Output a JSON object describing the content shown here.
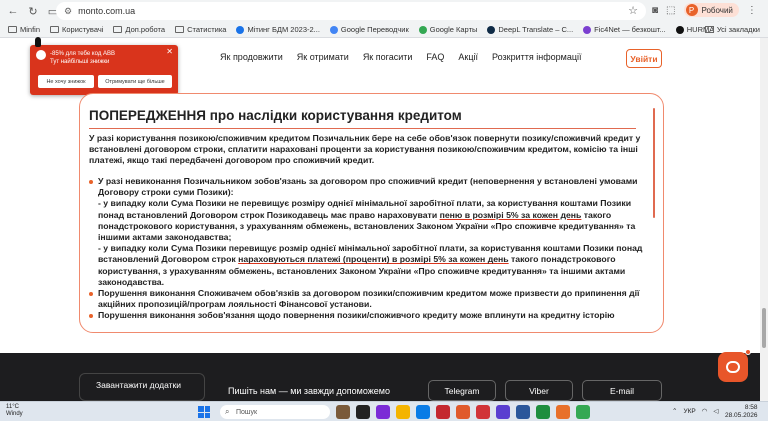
{
  "browser": {
    "url": "monto.com.ua",
    "profile_initial": "Р",
    "profile_name": "Робочий",
    "bookmarks": [
      "Minfin",
      "Користувачі",
      "Доп.робота",
      "Статистика",
      "Мітинг БДМ 2023-2...",
      "Google Переводчик",
      "Google Карты",
      "DeepL Translate – С...",
      "Fic4Net — безкошт...",
      "HURMA"
    ],
    "all_bookmarks": "Усі закладки"
  },
  "site": {
    "nav": [
      "Як продовжити",
      "Як отримати",
      "Як погасити",
      "FAQ",
      "Акції",
      "Розкриття інформації"
    ],
    "login": "Увійти"
  },
  "popup": {
    "line1": "-85% для тебе код АВВ",
    "line2": "Тут найбільші знижки",
    "decline": "Не хочу знижок",
    "accept": "Отримувати ще більше"
  },
  "warning": {
    "title": "ПОПЕРЕДЖЕННЯ про наслідки користування кредитом",
    "intro": "У разі користування позикою/споживчим кредитом Позичальник бере на себе обов'язок повернути позику/споживчий кредит у встановлені договором строки, сплатити нараховані проценти за користування позикою/споживчим кредитом, комісію та інші платежі, якщо такі передбачені договором про споживчий кредит.",
    "b1_head": "У разі невиконання Позичальником зобов'язань за договором про споживчий кредит (неповернення у встановлені умовами Договору строки суми Позики):",
    "b1_p1_before": "- у випадку коли Сума Позики не перевищує розміру однієї мінімальної заробітної плати, за користування коштами Позики понад встановлений Договором строк Позикодавець має право нараховувати ",
    "b1_p1_u": "пеню в розмірі 5% за кожен день",
    "b1_p1_after": " такого понадстрокового користування, з урахуванням обмежень, встановлених Законом України «Про споживче кредитування» та іншими актами законодавства;",
    "b1_p2_before": "- у випадку коли Сума Позики перевищує розмір однієї мінімальної заробітної плати, за користування коштами Позики понад встановлений Договором строк ",
    "b1_p2_u": "нараховуються платежі (проценти) в розмірі 5% за кожен день",
    "b1_p2_after": " такого понадстрокового користування, з урахуванням обмежень, встановлених Законом України «Про споживче кредитування» та іншими актами законодавства.",
    "b2": "Порушення виконання Споживачем обов'язків за договором позики/споживчим кредитом може призвести до припинення дії акційних пропозицій/програм лояльності Фінансової установи.",
    "b3": "Порушення виконання зобов'язання щодо повернення позики/споживчого кредиту може вплинути на кредитну історію"
  },
  "footer": {
    "download": "Завантажити додатки",
    "write": "Пишіть нам — ми завжди допоможемо",
    "telegram": "Telegram",
    "viber": "Viber",
    "email": "E-mail"
  },
  "taskbar": {
    "temp": "11°C",
    "weather": "Windy",
    "search": "Пошук",
    "lang": "УКР",
    "time": "8:58",
    "date": "28.05.2026"
  },
  "colors": {
    "accent": "#e8622a",
    "popup": "#d9341c",
    "footer": "#1d1d1f"
  }
}
